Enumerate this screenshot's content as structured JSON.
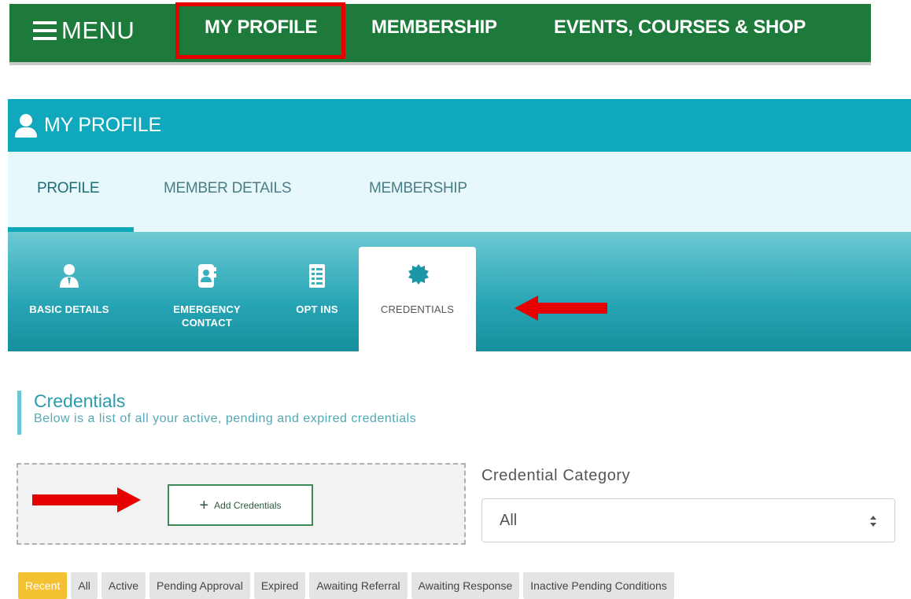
{
  "top_nav": {
    "menu_label": "MENU",
    "links": [
      "MY PROFILE",
      "MEMBERSHIP",
      "EVENTS, COURSES & SHOP"
    ]
  },
  "profile_header": {
    "title": "MY PROFILE"
  },
  "tabs": [
    "PROFILE",
    "MEMBER DETAILS",
    "MEMBERSHIP"
  ],
  "subtabs": [
    {
      "label": "BASIC DETAILS",
      "icon": "person-badge-icon"
    },
    {
      "label": "EMERGENCY CONTACT",
      "icon": "contact-card-icon"
    },
    {
      "label": "OPT INS",
      "icon": "checklist-icon"
    },
    {
      "label": "CREDENTIALS",
      "icon": "badge-seal-icon"
    }
  ],
  "credentials": {
    "title": "Credentials",
    "subtitle": "Below is a list of all your active, pending and expired credentials",
    "add_button": "Add Credentials",
    "category_label": "Credential Category",
    "category_value": "All"
  },
  "filters": [
    "Recent",
    "All",
    "Active",
    "Pending Approval",
    "Expired",
    "Awaiting Referral",
    "Awaiting Response",
    "Inactive Pending Conditions"
  ],
  "colors": {
    "nav_green": "#1d7a3a",
    "header_teal": "#0fa8bd",
    "highlight_red": "#e60000",
    "active_filter": "#f4c132"
  }
}
